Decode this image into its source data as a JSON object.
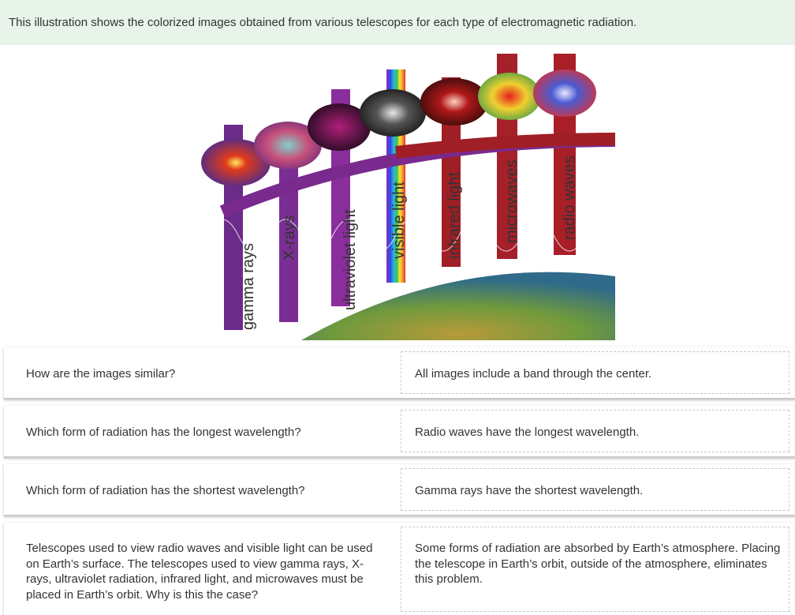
{
  "banner": {
    "text": "This illustration shows the colorized images obtained from various telescopes for each type of electromagnetic radiation."
  },
  "illustration": {
    "labels": [
      "gamma rays",
      "X-rays",
      "ultraviolet light",
      "visible light",
      "infrared light",
      "microwaves",
      "radio waves"
    ],
    "colors": {
      "gamma": "#6b2b8a",
      "xray": "#7a2e93",
      "uv": "#8a2e9b",
      "visible": "rainbow",
      "infrared": "#a01e25",
      "microwave": "#a52029",
      "radio": "#a81f27",
      "earth": "#7ba04a"
    }
  },
  "rows": [
    {
      "question": "How are the images similar?",
      "answer": "All images include a band through the center."
    },
    {
      "question": "Which form of radiation has the longest wavelength?",
      "answer": "Radio waves have the longest wavelength."
    },
    {
      "question": "Which form of radiation has the shortest wavelength?",
      "answer": "Gamma rays have the shortest wavelength."
    },
    {
      "question": "Telescopes used to view radio waves and visible light can be used on Earth’s surface. The telescopes used to view gamma rays, X-rays, ultraviolet radiation, infrared light, and microwaves must be placed in Earth’s orbit. Why is this the case?",
      "answer": "Some forms of radiation are absorbed by Earth’s atmosphere. Placing the telescope in Earth’s orbit, outside of the atmosphere, eliminates this problem."
    }
  ]
}
